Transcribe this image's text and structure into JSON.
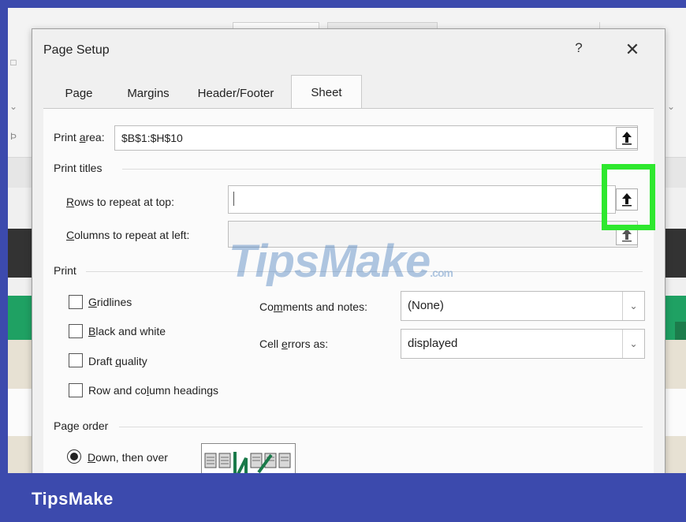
{
  "dialog": {
    "title": "Page Setup",
    "help": "?",
    "close": "✕"
  },
  "tabs": [
    {
      "label": "Page",
      "active": false
    },
    {
      "label": "Margins",
      "active": false
    },
    {
      "label": "Header/Footer",
      "active": false
    },
    {
      "label": "Sheet",
      "active": true
    }
  ],
  "print_area": {
    "label_pre": "Print ",
    "label_key": "a",
    "label_post": "rea:",
    "value": "$B$1:$H$10"
  },
  "print_titles": {
    "heading": "Print titles",
    "rows_label_key": "R",
    "rows_label_rest": "ows to repeat at top:",
    "rows_value": "",
    "cols_label_key": "C",
    "cols_label_rest": "olumns to repeat at left:",
    "cols_value": ""
  },
  "print": {
    "heading": "Print",
    "gridlines_key": "G",
    "gridlines_rest": "ridlines",
    "bw_key": "B",
    "bw_rest": "lack and white",
    "draft_pre": "Draft ",
    "draft_key": "q",
    "draft_post": "uality",
    "rowcol_pre": "Row and co",
    "rowcol_key": "l",
    "rowcol_post": "umn headings",
    "comments_pre": "Co",
    "comments_key": "m",
    "comments_post": "ments and notes:",
    "comments_value": "(None)",
    "errors_pre": "Cell ",
    "errors_key": "e",
    "errors_post": "rrors as:",
    "errors_value": "displayed"
  },
  "page_order": {
    "heading": "Page order",
    "down_key": "D",
    "down_rest": "own, then over",
    "down_selected": true
  },
  "watermark": {
    "main": "TipsMake",
    "suffix": ".com"
  },
  "brand": "TipsMake",
  "colors": {
    "highlight": "#2ee82e",
    "footer": "#3c4aad",
    "excel_green": "#1fa163"
  }
}
